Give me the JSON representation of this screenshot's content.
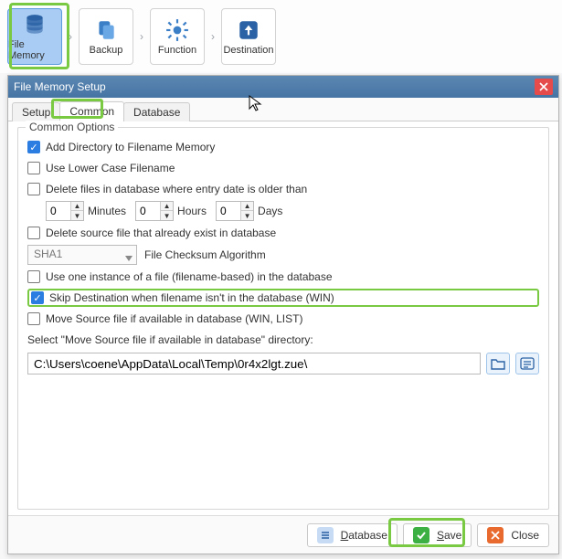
{
  "wizard": {
    "steps": [
      {
        "label": "File Memory"
      },
      {
        "label": "Backup"
      },
      {
        "label": "Function"
      },
      {
        "label": "Destination"
      }
    ]
  },
  "dialog": {
    "title": "File Memory Setup",
    "tabs": {
      "setup": "Setup",
      "common": "Common",
      "database": "Database"
    }
  },
  "options": {
    "legend": "Common Options",
    "add_dir": {
      "label": "Add Directory to Filename Memory",
      "checked": true
    },
    "lowercase": {
      "label": "Use Lower Case Filename",
      "checked": false
    },
    "delete_older": {
      "label": "Delete files in database where entry date is older than",
      "checked": false,
      "minutes": "0",
      "minutes_unit": "Minutes",
      "hours": "0",
      "hours_unit": "Hours",
      "days": "0",
      "days_unit": "Days"
    },
    "delete_source": {
      "label": "Delete source file that already exist in database",
      "checked": false
    },
    "checksum": {
      "value": "SHA1",
      "label": "File Checksum Algorithm"
    },
    "one_instance": {
      "label": "Use one instance of a file (filename-based) in the database",
      "checked": false
    },
    "skip_dest": {
      "label": "Skip Destination when filename isn't  in the database (WIN)",
      "checked": true
    },
    "move_source": {
      "label": "Move Source file if available in database (WIN, LIST)",
      "checked": false
    },
    "select_dir_label": "Select \"Move Source file if available in database\" directory:",
    "path": "C:\\Users\\coene\\AppData\\Local\\Temp\\0r4x2lgt.zue\\"
  },
  "footer": {
    "database": "Database",
    "save": "Save",
    "close": "Close"
  }
}
